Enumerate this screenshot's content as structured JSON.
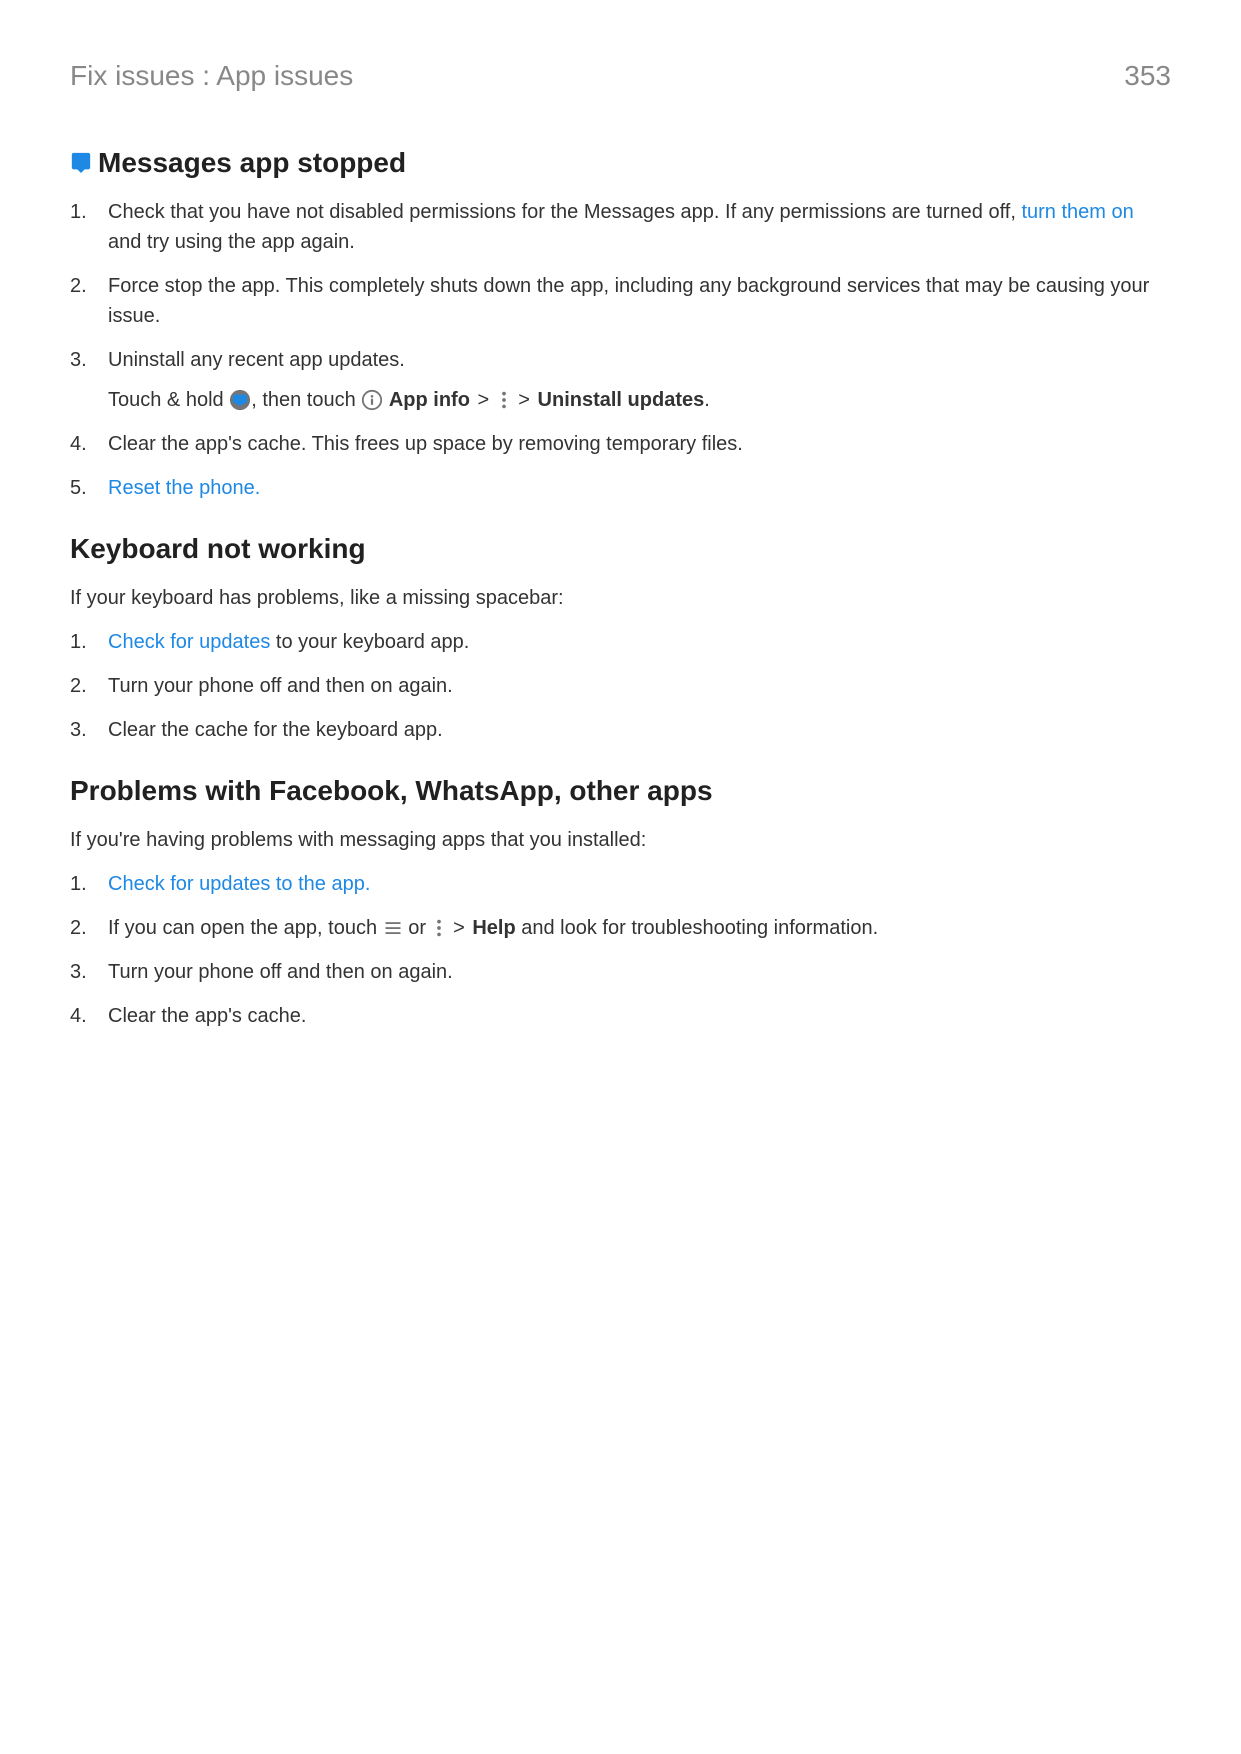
{
  "header": {
    "breadcrumb": "Fix issues : App issues",
    "page_number": "353"
  },
  "section1": {
    "heading": "Messages app stopped",
    "steps": [
      {
        "num": "1.",
        "pre": "Check that you have not disabled permissions for the Messages app. If any permissions are turned off, ",
        "link": "turn them on",
        "post": " and try using the app again."
      },
      {
        "num": "2.",
        "text": "Force stop the app. This completely shuts down the app, including any background services that may be causing your issue."
      },
      {
        "num": "3.",
        "text": "Uninstall any recent app updates.",
        "sub": {
          "t1": "Touch & hold ",
          "t2": ", then touch ",
          "app_info": "App info",
          "gt1": " > ",
          "gt2": " > ",
          "uninstall": "Uninstall updates",
          "period": "."
        }
      },
      {
        "num": "4.",
        "text": "Clear the app's cache. This frees up space by removing temporary files."
      },
      {
        "num": "5.",
        "link_full": "Reset the phone."
      }
    ]
  },
  "section2": {
    "heading": "Keyboard not working",
    "intro": "If your keyboard has problems, like a missing spacebar:",
    "steps": [
      {
        "num": "1.",
        "link": "Check for updates",
        "post": " to your keyboard app."
      },
      {
        "num": "2.",
        "text": "Turn your phone off and then on again."
      },
      {
        "num": "3.",
        "text": "Clear the cache for the keyboard app."
      }
    ]
  },
  "section3": {
    "heading": "Problems with Facebook, WhatsApp, other apps",
    "intro": "If you're having problems with messaging apps that you installed:",
    "steps": [
      {
        "num": "1.",
        "link_full": "Check for updates to the app."
      },
      {
        "num": "2.",
        "t1": "If you can open the app, touch ",
        "or": " or ",
        "gt": " > ",
        "help": "Help",
        "t2": " and look for troubleshooting information."
      },
      {
        "num": "3.",
        "text": "Turn your phone off and then on again."
      },
      {
        "num": "4.",
        "text": "Clear the app's cache."
      }
    ]
  }
}
